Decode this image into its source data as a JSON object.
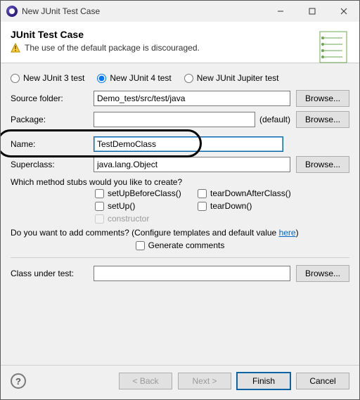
{
  "window": {
    "title": "New JUnit Test Case"
  },
  "header": {
    "heading": "JUnit Test Case",
    "warning": "The use of the default package is discouraged."
  },
  "radios": {
    "junit3": "New JUnit 3 test",
    "junit4": "New JUnit 4 test",
    "jupiter": "New JUnit Jupiter test",
    "selected": "junit4"
  },
  "fields": {
    "sourceFolder": {
      "label": "Source folder:",
      "value": "Demo_test/src/test/java",
      "browse": "Browse..."
    },
    "package": {
      "label": "Package:",
      "value": "",
      "suffix": "(default)",
      "browse": "Browse..."
    },
    "name": {
      "label": "Name:",
      "value": "TestDemoClass"
    },
    "superclass": {
      "label": "Superclass:",
      "value": "java.lang.Object",
      "browse": "Browse..."
    },
    "classUnderTest": {
      "label": "Class under test:",
      "value": "",
      "browse": "Browse..."
    }
  },
  "stubs": {
    "question": "Which method stubs would you like to create?",
    "setUpBeforeClass": "setUpBeforeClass()",
    "tearDownAfterClass": "tearDownAfterClass()",
    "setUp": "setUp()",
    "tearDown": "tearDown()",
    "constructor": "constructor"
  },
  "comments": {
    "question_prefix": "Do you want to add comments? (Configure templates and default value ",
    "link": "here",
    "question_suffix": ")",
    "generate": "Generate comments"
  },
  "footer": {
    "back": "< Back",
    "next": "Next >",
    "finish": "Finish",
    "cancel": "Cancel"
  }
}
